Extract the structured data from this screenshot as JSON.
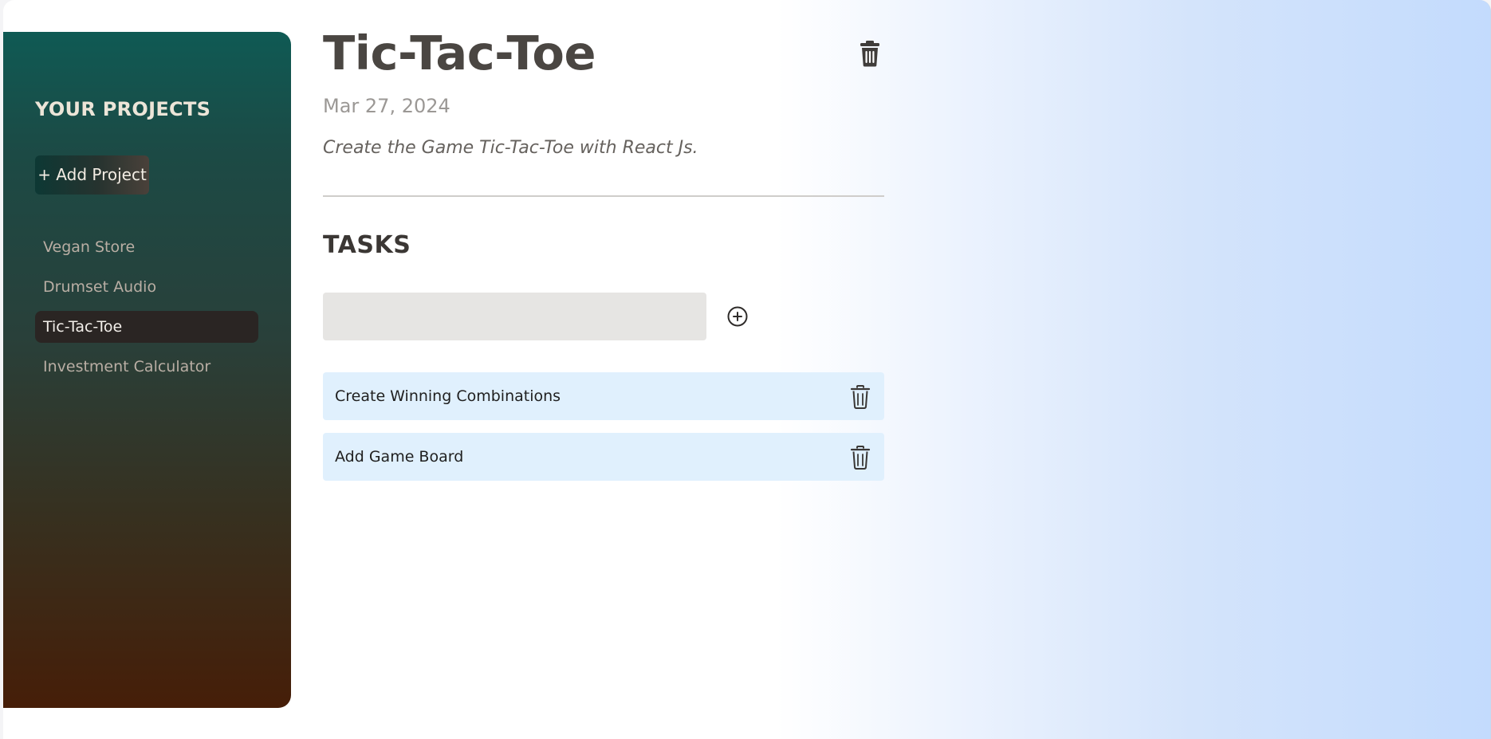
{
  "sidebar": {
    "title": "YOUR PROJECTS",
    "add_button_label": "+ Add Project",
    "projects": [
      {
        "label": "Vegan Store",
        "selected": false
      },
      {
        "label": "Drumset Audio",
        "selected": false
      },
      {
        "label": "Tic-Tac-Toe",
        "selected": true
      },
      {
        "label": "Investment Calculator",
        "selected": false
      }
    ]
  },
  "project": {
    "title": "Tic-Tac-Toe",
    "date": "Mar 27, 2024",
    "description": "Create the Game Tic-Tac-Toe with React Js.",
    "delete_icon": "trash-filled-icon"
  },
  "tasks": {
    "heading": "TASKS",
    "input_value": "",
    "add_icon": "plus-circle-icon",
    "items": [
      {
        "label": "Create Winning Combinations",
        "delete_icon": "trash-outline-icon"
      },
      {
        "label": "Add Game Board",
        "delete_icon": "trash-outline-icon"
      }
    ]
  },
  "colors": {
    "sidebar_top": "#0f5a54",
    "sidebar_bottom": "#461e08",
    "active_item": "#2a2523",
    "task_bg": "#e0f0fd",
    "input_bg": "#e6e5e3",
    "title_text": "#4a4642"
  }
}
